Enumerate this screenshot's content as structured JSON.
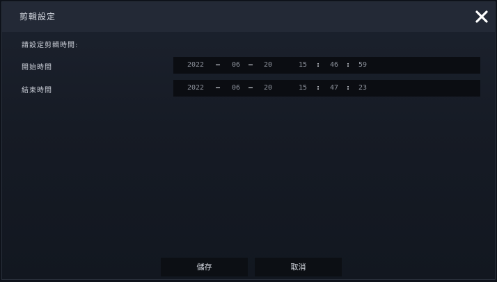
{
  "dialog": {
    "title": "剪輯設定",
    "close_icon": "close-icon"
  },
  "form": {
    "prompt": "請設定剪輯時間:",
    "rows": [
      {
        "label": "開始時間",
        "year": "2022",
        "month": "06",
        "day": "20",
        "hour": "15",
        "minute": "46",
        "second": "59"
      },
      {
        "label": "結束時間",
        "year": "2022",
        "month": "06",
        "day": "20",
        "hour": "15",
        "minute": "47",
        "second": "23"
      }
    ],
    "date_separator": "–",
    "time_separator": ":"
  },
  "buttons": {
    "save": "儲存",
    "cancel": "取消"
  }
}
